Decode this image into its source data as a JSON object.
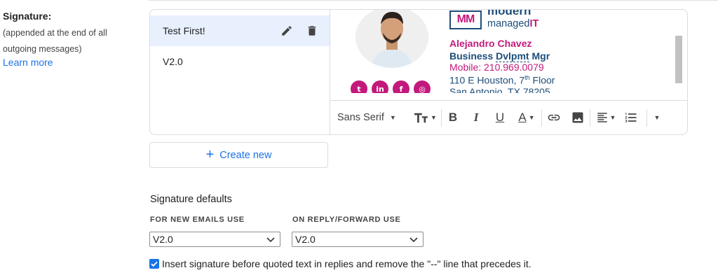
{
  "settings": {
    "signature_label": "Signature:",
    "signature_desc": "(appended at the end of all outgoing messages)",
    "learn_more": "Learn more"
  },
  "signatures": [
    {
      "name": "Test First!",
      "selected": true
    },
    {
      "name": "V2.0",
      "selected": false
    }
  ],
  "preview": {
    "logo_top": "modern",
    "logo_bottom_a": "managed",
    "logo_bottom_b": "IT",
    "logo_mark": "MM",
    "name": "Alejandro Chavez",
    "role_prefix": "Business ",
    "role_underlined": "Dvlpmt",
    "role_suffix": " Mgr",
    "mobile": "Mobile: 210.969.0079",
    "address1_a": "110 E Houston, 7",
    "address1_sup": "th",
    "address1_b": " Floor",
    "address2": "San Antonio, TX 78205",
    "socials": [
      "twitter-icon",
      "linkedin-icon",
      "facebook-icon",
      "instagram-icon"
    ],
    "brand_pink": "#c2197c",
    "brand_navy": "#1d4e7a"
  },
  "toolbar": {
    "font": "Sans Serif"
  },
  "create_new": "Create new",
  "defaults": {
    "title": "Signature defaults",
    "new_label": "FOR NEW EMAILS USE",
    "new_value": "V2.0",
    "reply_label": "ON REPLY/FORWARD USE",
    "reply_value": "V2.0"
  },
  "insert_text": "Insert signature before quoted text in replies and remove the \"--\" line that precedes it.",
  "accent_color": "#1a73e8"
}
